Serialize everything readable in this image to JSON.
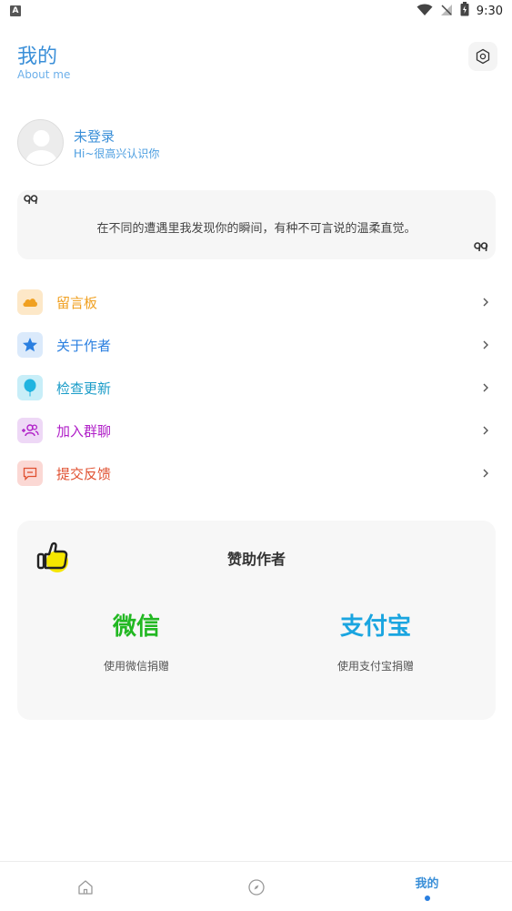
{
  "status_bar": {
    "time": "9:30",
    "app_icon": "A"
  },
  "header": {
    "title": "我的",
    "subtitle": "About me"
  },
  "profile": {
    "name": "未登录",
    "greeting": "Hi~很高兴认识你"
  },
  "quote": {
    "open_mark": "ⱷⱷ",
    "text": "在不同的遭遇里我发现你的瞬间，有种不可言说的温柔直觉。",
    "close_mark": "99"
  },
  "menu": [
    {
      "label": "留言板",
      "icon": "cloud-icon",
      "color": "#f0a020",
      "bg": "#fde8c8"
    },
    {
      "label": "关于作者",
      "icon": "star-icon",
      "color": "#2a7fe0",
      "bg": "#dbeafb"
    },
    {
      "label": "检查更新",
      "icon": "balloon-icon",
      "color": "#1a9cc8",
      "bg": "#c8eef8"
    },
    {
      "label": "加入群聊",
      "icon": "add-group-icon",
      "color": "#b020c8",
      "bg": "#eed8f6"
    },
    {
      "label": "提交反馈",
      "icon": "feedback-icon",
      "color": "#e05030",
      "bg": "#fbd8d4"
    }
  ],
  "sponsor": {
    "title": "赞助作者",
    "wechat": {
      "title": "微信",
      "subtitle": "使用微信捐赠",
      "color": "#22b822"
    },
    "alipay": {
      "title": "支付宝",
      "subtitle": "使用支付宝捐赠",
      "color": "#1aa5e0"
    }
  },
  "bottom_nav": {
    "tabs": [
      {
        "name": "home",
        "icon": "home-icon"
      },
      {
        "name": "discover",
        "icon": "compass-icon"
      },
      {
        "name": "me",
        "label": "我的",
        "active": true
      }
    ]
  }
}
